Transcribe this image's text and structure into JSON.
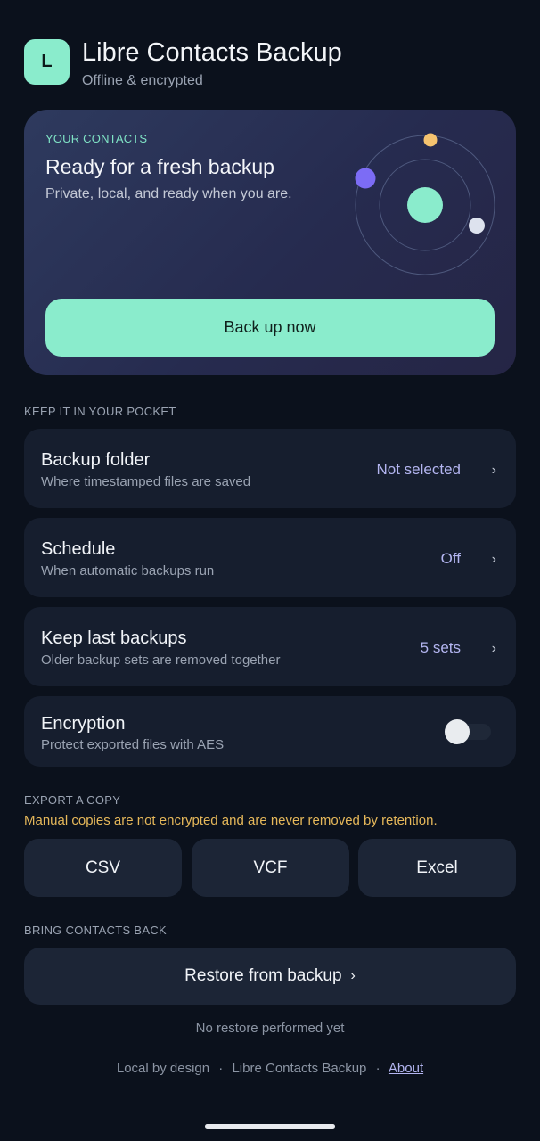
{
  "app": {
    "logo_letter": "L",
    "title": "Libre Contacts Backup",
    "subtitle": "Offline & encrypted"
  },
  "hero": {
    "eyebrow": "YOUR CONTACTS",
    "title": "Ready for a fresh backup",
    "subtitle": "Private, local, and ready when you are.",
    "button_label": "Back up now"
  },
  "settings_section": {
    "label": "KEEP IT IN YOUR POCKET",
    "items": [
      {
        "title": "Backup folder",
        "subtitle": "Where timestamped files are saved",
        "value": "Not selected",
        "chevron": "›"
      },
      {
        "title": "Schedule",
        "subtitle": "When automatic backups run",
        "value": "Off",
        "chevron": "›"
      },
      {
        "title": "Keep last backups",
        "subtitle": "Older backup sets are removed together",
        "value": "5 sets",
        "chevron": "›"
      }
    ],
    "encryption": {
      "title": "Encryption",
      "subtitle": "Protect exported files with AES",
      "enabled": false
    }
  },
  "export_section": {
    "label": "EXPORT A COPY",
    "warning": "Manual copies are not encrypted and are never removed by retention.",
    "buttons": [
      "CSV",
      "VCF",
      "Excel"
    ]
  },
  "restore_section": {
    "label": "BRING CONTACTS BACK",
    "button_label": "Restore from backup",
    "button_chevron": "›",
    "status": "No restore performed yet"
  },
  "footer": {
    "part1": "Local by design",
    "separator": "·",
    "part2": "Libre Contacts Backup",
    "about": "About"
  },
  "colors": {
    "background": "#0b111c",
    "accent": "#8aeccc",
    "card": "#161e2e",
    "value": "#b3b5f0",
    "warning": "#e6b85a"
  }
}
